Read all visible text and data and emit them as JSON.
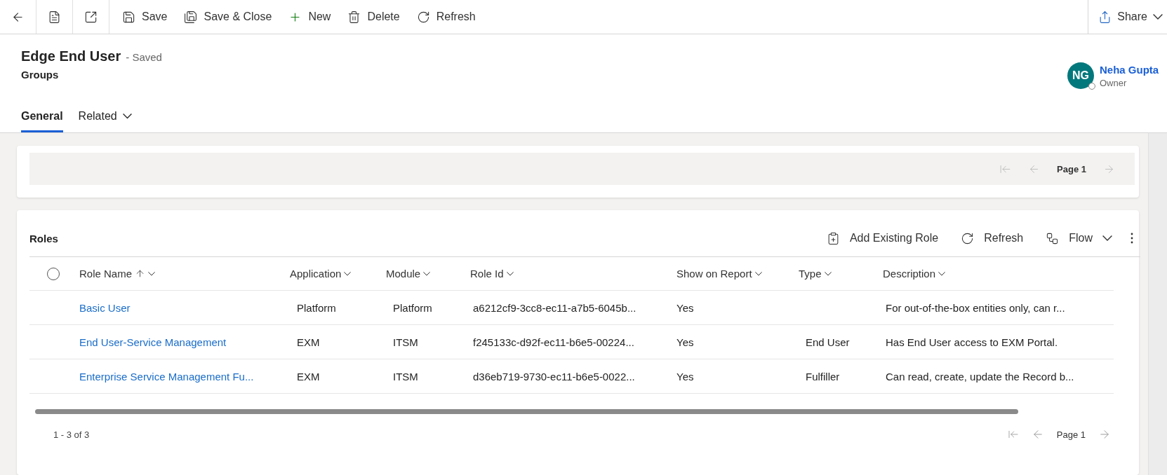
{
  "command_bar": {
    "nav_buttons": [
      {
        "kind": "back"
      },
      {
        "kind": "form"
      },
      {
        "kind": "popout"
      }
    ],
    "actions": [
      {
        "kind": "save",
        "label": "Save"
      },
      {
        "kind": "save_close",
        "label": "Save & Close"
      },
      {
        "kind": "new",
        "label": "New"
      },
      {
        "kind": "delete",
        "label": "Delete"
      },
      {
        "kind": "refresh",
        "label": "Refresh"
      }
    ],
    "share": {
      "label": "Share"
    }
  },
  "header": {
    "title": "Edge End User",
    "status": "- Saved",
    "entity": "Groups",
    "owner": {
      "initials": "NG",
      "name": "Neha Gupta",
      "role": "Owner"
    }
  },
  "tabs": [
    {
      "label": "General",
      "selected": true,
      "dropdown": false
    },
    {
      "label": "Related",
      "selected": false,
      "dropdown": true
    }
  ],
  "top_card": {
    "pager": {
      "page": "Page 1"
    }
  },
  "roles": {
    "title": "Roles",
    "commands": [
      {
        "kind": "add",
        "label": "Add Existing Role"
      },
      {
        "kind": "refresh",
        "label": "Refresh"
      },
      {
        "kind": "flow",
        "label": "Flow"
      }
    ],
    "columns": [
      {
        "label": "Role Name",
        "sorted": true
      },
      {
        "label": "Application",
        "sorted": false
      },
      {
        "label": "Module",
        "sorted": false
      },
      {
        "label": "Role Id",
        "sorted": false
      },
      {
        "label": "Show on Report",
        "sorted": false
      },
      {
        "label": "Type",
        "sorted": false
      },
      {
        "label": "Description",
        "sorted": false
      }
    ],
    "rows": [
      {
        "cells": [
          "Basic User",
          "Platform",
          "Platform",
          "a6212cf9-3cc8-ec11-a7b5-6045b...",
          "Yes",
          "",
          "For out-of-the-box entities only, can r..."
        ]
      },
      {
        "cells": [
          "End User-Service Management",
          "EXM",
          "ITSM",
          "f245133c-d92f-ec11-b6e5-00224...",
          "Yes",
          "End User",
          "Has End User access to EXM Portal."
        ]
      },
      {
        "cells": [
          "Enterprise Service Management Fu...",
          "EXM",
          "ITSM",
          "d36eb719-9730-ec11-b6e5-0022...",
          "Yes",
          "Fulfiller",
          "Can read, create, update the Record b..."
        ]
      }
    ],
    "select_all": {
      "checked": false
    },
    "count": "1 - 3 of 3",
    "page": "Page 1"
  }
}
